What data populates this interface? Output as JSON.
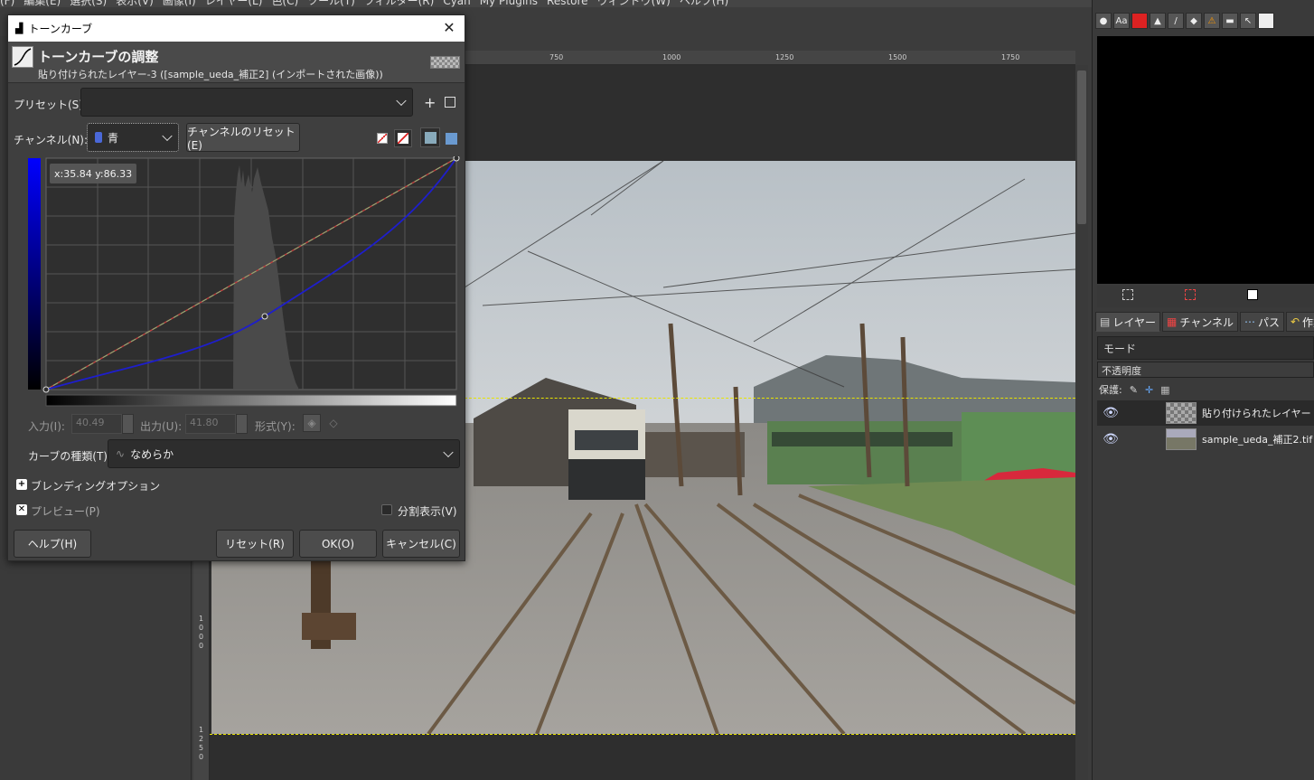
{
  "menubar": {
    "items": [
      "(F)",
      "編集(E)",
      "選択(S)",
      "表示(V)",
      "画像(I)",
      "レイヤー(L)",
      "色(C)",
      "ツール(T)",
      "フィルター(R)",
      "Cyan",
      "My Plugins",
      "Restore",
      "ウィンドウ(W)",
      "ヘルプ(H)"
    ]
  },
  "ruler": {
    "ticks": [
      "750",
      "1000",
      "1250",
      "1500",
      "1750"
    ],
    "left_ticks": [
      "1",
      "0",
      "0",
      "0",
      "1",
      "2",
      "5",
      "0"
    ]
  },
  "dialog": {
    "window_title": "トーンカーブ",
    "close_glyph": "✕",
    "header_title": "トーンカーブの調整",
    "header_subtitle": "貼り付けられたレイヤー-3 ([sample_ueda_補正2] (インポートされた画像))",
    "preset_label": "プリセット(S):",
    "preset_value": "",
    "preset_add": "+",
    "channel_label": "チャンネル(N):",
    "channel_value": "青",
    "channel_reset": "チャンネルのリセット(E)",
    "coordinate_readout": "x:35.84 y:86.33",
    "input_label": "入力(I):",
    "input_value": "40.49",
    "output_label": "出力(U):",
    "output_value": "41.80",
    "type_label": "形式(Y):",
    "curve_type_label": "カーブの種類(T)",
    "curve_type_value": "なめらか",
    "blending_label": "ブレンディングオプション",
    "preview_label": "プレビュー(P)",
    "preview_checked": true,
    "split_label": "分割表示(V)",
    "split_checked": false,
    "help_btn": "ヘルプ(H)",
    "reset_btn": "リセット(R)",
    "ok_btn": "OK(O)",
    "cancel_btn": "キャンセル(C)"
  },
  "dock": {
    "tabs": [
      "レイヤー",
      "チャンネル",
      "パス",
      "作業履歴"
    ],
    "mode_label": "モード",
    "opacity_label": "不透明度",
    "lock_label": "保護:",
    "layers": [
      {
        "name": "貼り付けられたレイヤー",
        "visible": true,
        "selected": true
      },
      {
        "name": "sample_ueda_補正2.tif",
        "visible": true,
        "selected": false
      }
    ]
  },
  "colors": {
    "accent_blue": "#0000ff",
    "curve_blue": "#1e1ecc",
    "selection_dash": "#e7e400"
  }
}
